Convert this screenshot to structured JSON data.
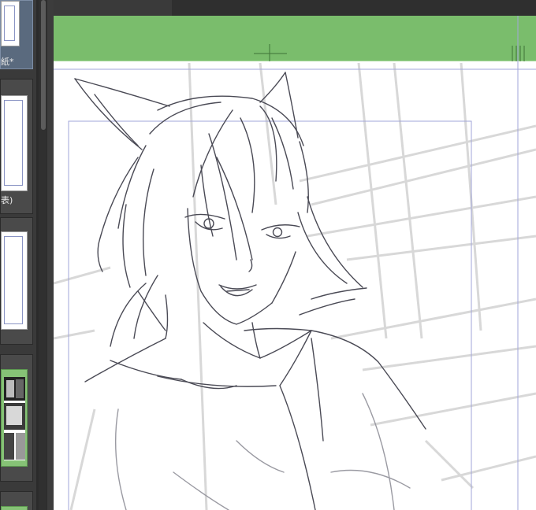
{
  "thumbnails": [
    {
      "label": "紙*",
      "state": "active"
    },
    {
      "label": "表)",
      "state": "normal"
    },
    {
      "label": "",
      "state": "normal"
    },
    {
      "label": "",
      "state": "green"
    },
    {
      "label": "",
      "state": "green"
    }
  ],
  "colors": {
    "canvas": "#ffffff",
    "toolbar_green": "#7abd6c",
    "frame_line": "#a2a6d8",
    "sketch_line": "#4a4a55",
    "perspective_guide": "#d6d6d6",
    "panel_bg": "#3a3a3a"
  },
  "icons": [
    "crosshair-marker-icon",
    "ruler-tick-icon"
  ]
}
